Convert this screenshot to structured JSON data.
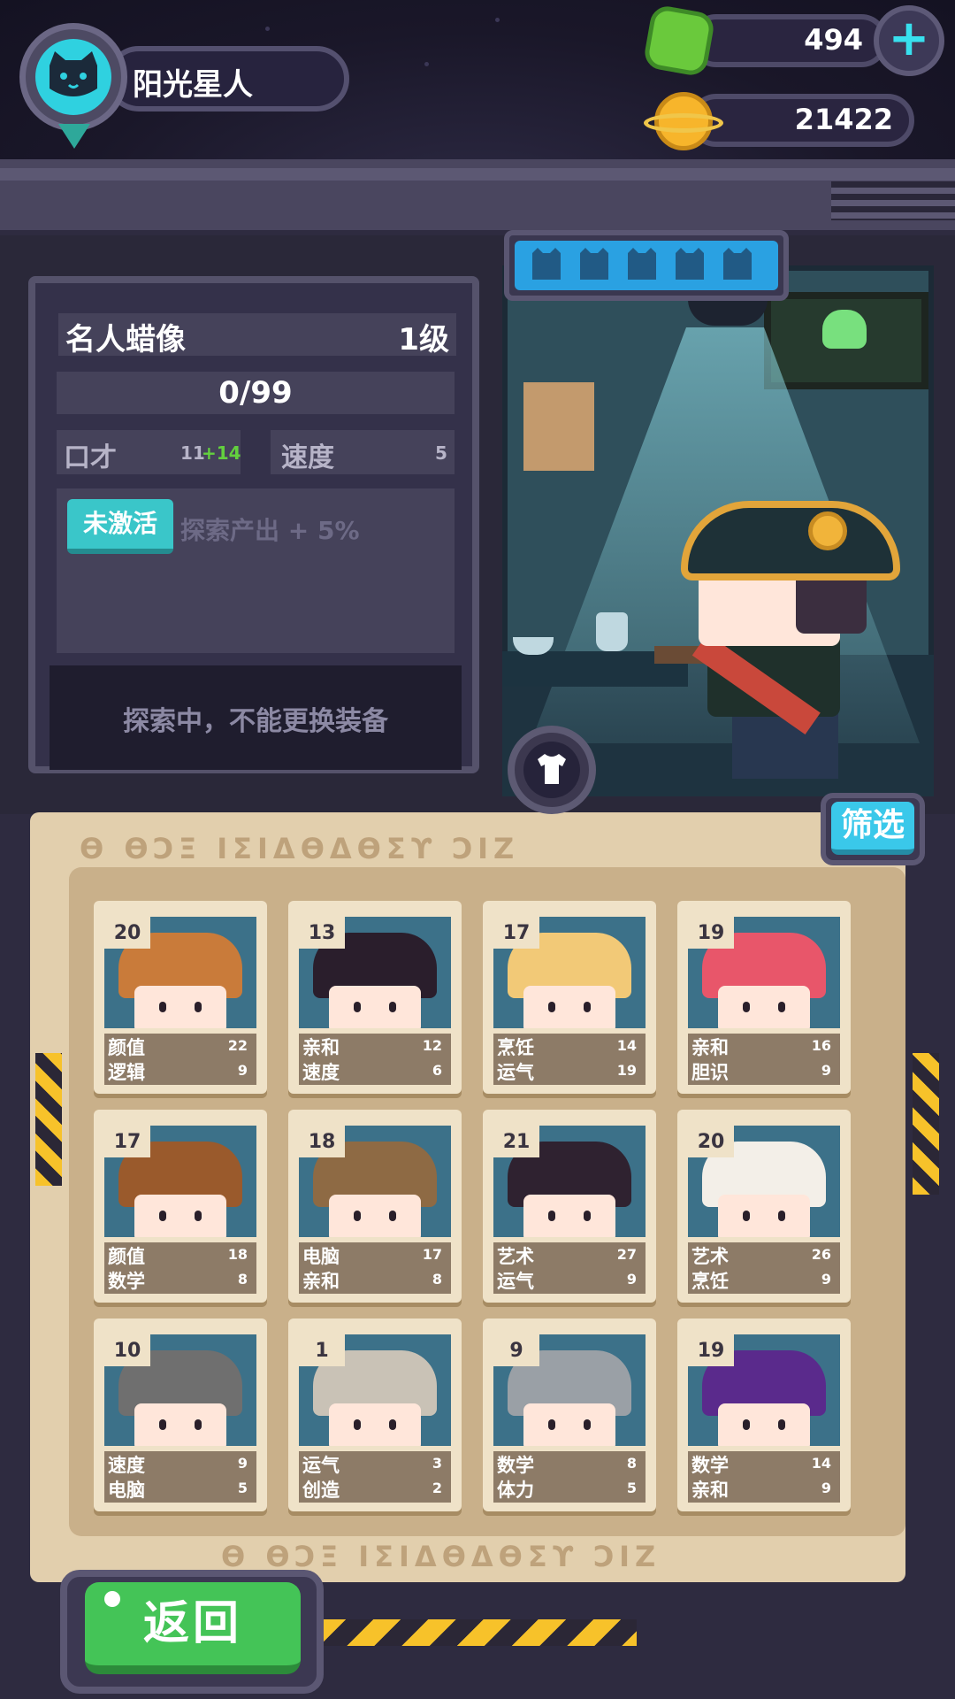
{
  "player": {
    "name": "阳光星人"
  },
  "currency": {
    "gems": "494",
    "coins": "21422"
  },
  "equipment": {
    "title": "名人蜡像",
    "level": "1级",
    "progress": "0/99",
    "stats": [
      {
        "label": "口才",
        "value": "11",
        "bonus": "+14"
      },
      {
        "label": "速度",
        "value": "5"
      }
    ],
    "status_badge": "未激活",
    "effect": "探索产出 + 5%",
    "lock_message": "探索中，不能更换装备",
    "slots_filled": 0,
    "slots_total": 5
  },
  "buttons": {
    "filter": "筛选",
    "back": "返回"
  },
  "board": {
    "glyphs": "ϴ ϴϽΞ ΙΣΙΔϴΔϴΣϒ ϽΙΖ"
  },
  "cards": [
    {
      "level": "20",
      "stats": [
        {
          "label": "颜值",
          "value": "22"
        },
        {
          "label": "逻辑",
          "value": "9"
        }
      ],
      "hair": "#c97b3a"
    },
    {
      "level": "13",
      "stats": [
        {
          "label": "亲和",
          "value": "12"
        },
        {
          "label": "速度",
          "value": "6"
        }
      ],
      "hair": "#2a1e2c"
    },
    {
      "level": "17",
      "stats": [
        {
          "label": "烹饪",
          "value": "14"
        },
        {
          "label": "运气",
          "value": "19"
        }
      ],
      "hair": "#f2c977"
    },
    {
      "level": "19",
      "stats": [
        {
          "label": "亲和",
          "value": "16"
        },
        {
          "label": "胆识",
          "value": "9"
        }
      ],
      "hair": "#e8566a"
    },
    {
      "level": "17",
      "stats": [
        {
          "label": "颜值",
          "value": "18"
        },
        {
          "label": "数学",
          "value": "8"
        }
      ],
      "hair": "#9a5a2c"
    },
    {
      "level": "18",
      "stats": [
        {
          "label": "电脑",
          "value": "17"
        },
        {
          "label": "亲和",
          "value": "8"
        }
      ],
      "hair": "#8e6a44"
    },
    {
      "level": "21",
      "stats": [
        {
          "label": "艺术",
          "value": "27"
        },
        {
          "label": "运气",
          "value": "9"
        }
      ],
      "hair": "#2f2230"
    },
    {
      "level": "20",
      "stats": [
        {
          "label": "艺术",
          "value": "26"
        },
        {
          "label": "烹饪",
          "value": "9"
        }
      ],
      "hair": "#f3efe8"
    },
    {
      "level": "10",
      "stats": [
        {
          "label": "速度",
          "value": "9"
        },
        {
          "label": "电脑",
          "value": "5"
        }
      ],
      "hair": "#6f6f6f"
    },
    {
      "level": "1",
      "stats": [
        {
          "label": "运气",
          "value": "3"
        },
        {
          "label": "创造",
          "value": "2"
        }
      ],
      "hair": "#c9c2b6"
    },
    {
      "level": "9",
      "stats": [
        {
          "label": "数学",
          "value": "8"
        },
        {
          "label": "体力",
          "value": "5"
        }
      ],
      "hair": "#9aa0a6"
    },
    {
      "level": "19",
      "stats": [
        {
          "label": "数学",
          "value": "14"
        },
        {
          "label": "亲和",
          "value": "9"
        }
      ],
      "hair": "#5a2a8c"
    }
  ]
}
